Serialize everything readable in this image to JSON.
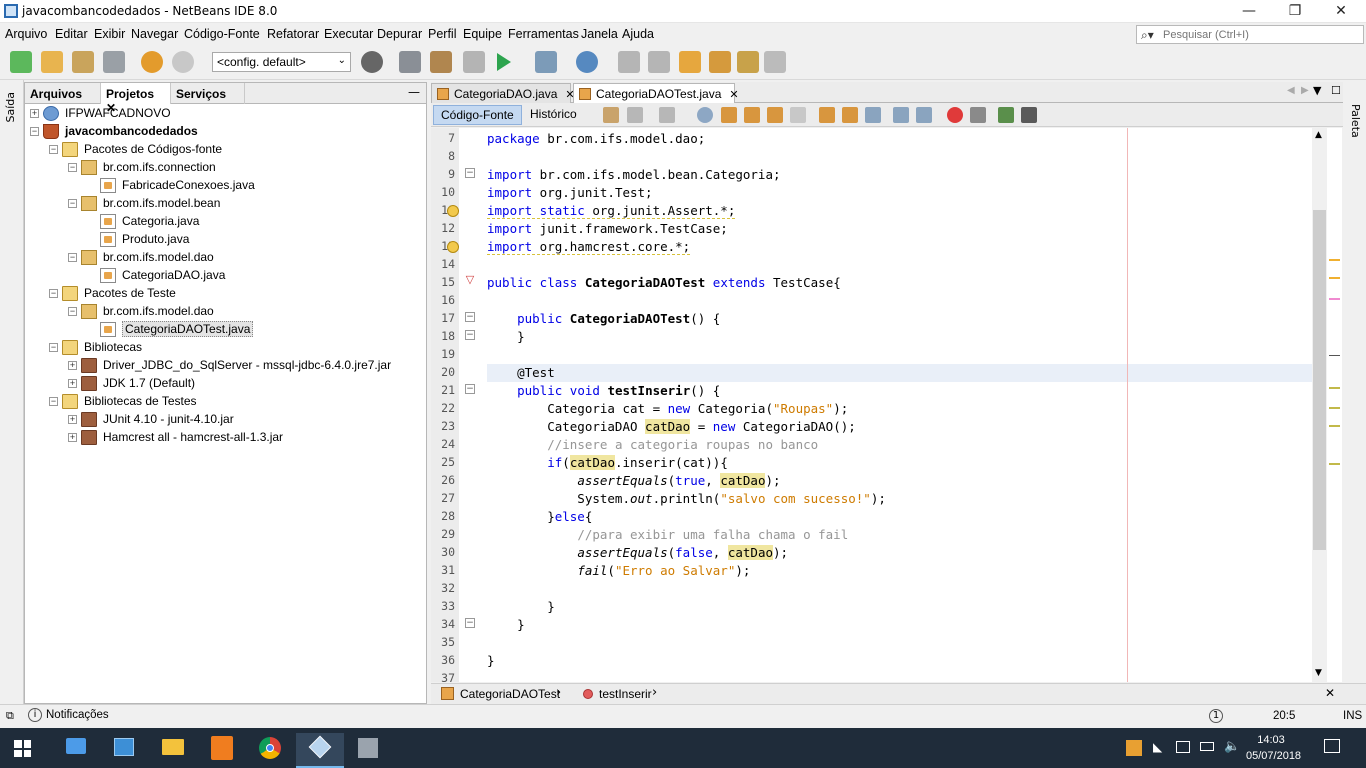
{
  "window": {
    "title": "javacombancodedados - NetBeans IDE 8.0",
    "minimize": "—",
    "maximize": "❐",
    "close": "✕"
  },
  "menu": [
    "Arquivo",
    "Editar",
    "Exibir",
    "Navegar",
    "Código-Fonte",
    "Refatorar",
    "Executar",
    "Depurar",
    "Perfil",
    "Equipe",
    "Ferramentas",
    "Janela",
    "Ajuda"
  ],
  "search": {
    "placeholder": "Pesquisar (Ctrl+I)"
  },
  "toolbar": {
    "config": "<config. default>"
  },
  "left_strip": {
    "label": "Saída"
  },
  "project_panel": {
    "tabs": [
      "Arquivos",
      "Projetos",
      "Serviços"
    ],
    "tree": [
      {
        "label": "IFPWAFCADNOVO",
        "icon": "globe-icon",
        "level": 0,
        "toggle": "+"
      },
      {
        "label": "javacombancodedados",
        "icon": "coffee-cup-icon",
        "level": 0,
        "toggle": "-",
        "bold": true
      },
      {
        "label": "Pacotes de Códigos-fonte",
        "icon": "folder-icon",
        "level": 1,
        "toggle": "-"
      },
      {
        "label": "br.com.ifs.connection",
        "icon": "package-icon",
        "level": 2,
        "toggle": "-"
      },
      {
        "label": "FabricadeConexoes.java",
        "icon": "java-file-icon",
        "level": 3,
        "toggle": ""
      },
      {
        "label": "br.com.ifs.model.bean",
        "icon": "package-icon",
        "level": 2,
        "toggle": "-"
      },
      {
        "label": "Categoria.java",
        "icon": "java-file-icon",
        "level": 3,
        "toggle": ""
      },
      {
        "label": "Produto.java",
        "icon": "java-file-icon",
        "level": 3,
        "toggle": ""
      },
      {
        "label": "br.com.ifs.model.dao",
        "icon": "package-icon",
        "level": 2,
        "toggle": "-"
      },
      {
        "label": "CategoriaDAO.java",
        "icon": "java-file-icon",
        "level": 3,
        "toggle": ""
      },
      {
        "label": "Pacotes de Teste",
        "icon": "folder-icon",
        "level": 1,
        "toggle": "-"
      },
      {
        "label": "br.com.ifs.model.dao",
        "icon": "package-icon",
        "level": 2,
        "toggle": "-"
      },
      {
        "label": "CategoriaDAOTest.java",
        "icon": "java-file-icon",
        "level": 3,
        "toggle": "",
        "selected": true
      },
      {
        "label": "Bibliotecas",
        "icon": "folder-icon",
        "level": 1,
        "toggle": "-"
      },
      {
        "label": "Driver_JDBC_do_SqlServer - mssql-jdbc-6.4.0.jre7.jar",
        "icon": "jar-icon",
        "level": 2,
        "toggle": "+"
      },
      {
        "label": "JDK 1.7 (Default)",
        "icon": "jar-icon",
        "level": 2,
        "toggle": "+"
      },
      {
        "label": "Bibliotecas de Testes",
        "icon": "folder-icon",
        "level": 1,
        "toggle": "-"
      },
      {
        "label": "JUnit 4.10 - junit-4.10.jar",
        "icon": "jar-icon",
        "level": 2,
        "toggle": "+"
      },
      {
        "label": "Hamcrest all - hamcrest-all-1.3.jar",
        "icon": "jar-icon",
        "level": 2,
        "toggle": "+"
      }
    ]
  },
  "editor": {
    "tabs": [
      {
        "label": "CategoriaDAO.java",
        "active": false
      },
      {
        "label": "CategoriaDAOTest.java",
        "active": true
      }
    ],
    "views": [
      "Código-Fonte",
      "Histórico"
    ],
    "lines": [
      {
        "n": "7",
        "html": "<span class='kw'>package</span> br.com.ifs.model.dao;"
      },
      {
        "n": "8",
        "html": ""
      },
      {
        "n": "9",
        "html": "<span class='kw'>import</span> br.com.ifs.model.bean.Categoria;"
      },
      {
        "n": "10",
        "html": "<span class='kw'>import</span> org.junit.Test;"
      },
      {
        "n": "11",
        "html": "<span class='sq'><span class='kw'>import static</span> org.junit.Assert.*;</span>",
        "warn": true
      },
      {
        "n": "12",
        "html": "<span class='kw'>import</span> junit.framework.TestCase;"
      },
      {
        "n": "13",
        "html": "<span class='sq'><span class='kw'>import</span> org.hamcrest.core.*;</span>",
        "warn": true
      },
      {
        "n": "14",
        "html": ""
      },
      {
        "n": "15",
        "html": "<span class='kw'>public class</span> <span class='bold'>CategoriaDAOTest</span> <span class='kw'>extends</span> TestCase{"
      },
      {
        "n": "16",
        "html": ""
      },
      {
        "n": "17",
        "html": "    <span class='kw'>public</span> <span class='bold'>CategoriaDAOTest</span>() {"
      },
      {
        "n": "18",
        "html": "    }"
      },
      {
        "n": "19",
        "html": ""
      },
      {
        "n": "20",
        "html": "    @Test",
        "current": true
      },
      {
        "n": "21",
        "html": "    <span class='kw'>public void</span> <span class='bold'>testInserir</span>() {"
      },
      {
        "n": "22",
        "html": "        Categoria cat = <span class='kw'>new</span> Categoria(<span class='str'>\"Roupas\"</span>);"
      },
      {
        "n": "23",
        "html": "        CategoriaDAO <span class='hl'>catDao</span> = <span class='kw'>new</span> CategoriaDAO();"
      },
      {
        "n": "24",
        "html": "        <span class='cm'>//insere a categoria roupas no banco</span>"
      },
      {
        "n": "25",
        "html": "        <span class='kw'>if</span>(<span class='hl'>catDao</span>.inserir(cat)){"
      },
      {
        "n": "26",
        "html": "            <span class='it'>assertEquals</span>(<span class='kw'>true</span>, <span class='hl'>catDao</span>);"
      },
      {
        "n": "27",
        "html": "            System.<span class='it'>out</span>.println(<span class='str'>\"salvo com sucesso!\"</span>);"
      },
      {
        "n": "28",
        "html": "        }<span class='kw'>else</span>{"
      },
      {
        "n": "29",
        "html": "            <span class='cm'>//para exibir uma falha chama o fail</span>"
      },
      {
        "n": "30",
        "html": "            <span class='it'>assertEquals</span>(<span class='kw'>false</span>, <span class='hl'>catDao</span>);"
      },
      {
        "n": "31",
        "html": "            <span class='it'>fail</span>(<span class='str'>\"Erro ao Salvar\"</span>);"
      },
      {
        "n": "32",
        "html": ""
      },
      {
        "n": "33",
        "html": "        }"
      },
      {
        "n": "34",
        "html": "    }"
      },
      {
        "n": "35",
        "html": ""
      },
      {
        "n": "36",
        "html": "}"
      },
      {
        "n": "37",
        "html": ""
      }
    ],
    "breadcrumbs": [
      "CategoriaDAOTest",
      "testInserir"
    ]
  },
  "right_strip": {
    "label": "Paleta"
  },
  "status": {
    "notifications": "Notificações",
    "position": "20:5",
    "mode": "INS"
  },
  "taskbar": {
    "time": "14:03",
    "date": "05/07/2018"
  }
}
